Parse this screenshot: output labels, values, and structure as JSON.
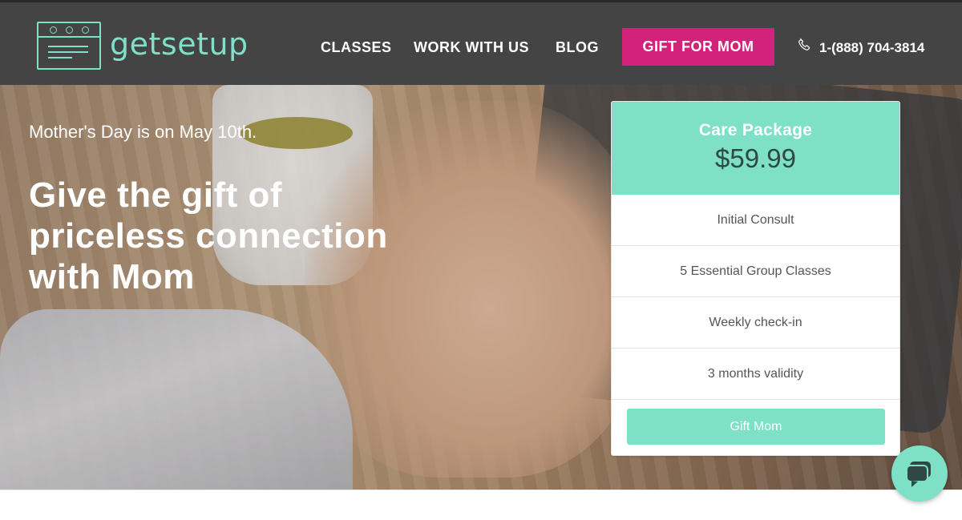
{
  "header": {
    "logo_text": "getsetup",
    "logo_steps": [
      "1",
      "2",
      "3"
    ],
    "nav": {
      "classes": "CLASSES",
      "work_with_us": "WORK WITH US",
      "blog": "BLOG"
    },
    "gift_button": "GIFT FOR MOM",
    "phone": "1-(888) 704-3814"
  },
  "hero": {
    "subhead": "Mother's Day is on May 10th.",
    "headline": "Give the gift of priceless connection with Mom"
  },
  "package": {
    "title": "Care Package",
    "price": "$59.99",
    "features": [
      "Initial Consult",
      "5 Essential Group Classes",
      "Weekly check-in",
      "3 months validity"
    ],
    "button": "Gift Mom"
  },
  "icons": {
    "logo": "calendar-steps-icon",
    "phone": "phone-icon",
    "chat": "chat-bubble-icon"
  },
  "colors": {
    "header_bg": "#444444",
    "brand_mint": "#7ee0c6",
    "gift_pink": "#d2227a",
    "price_text": "#2f4747"
  }
}
